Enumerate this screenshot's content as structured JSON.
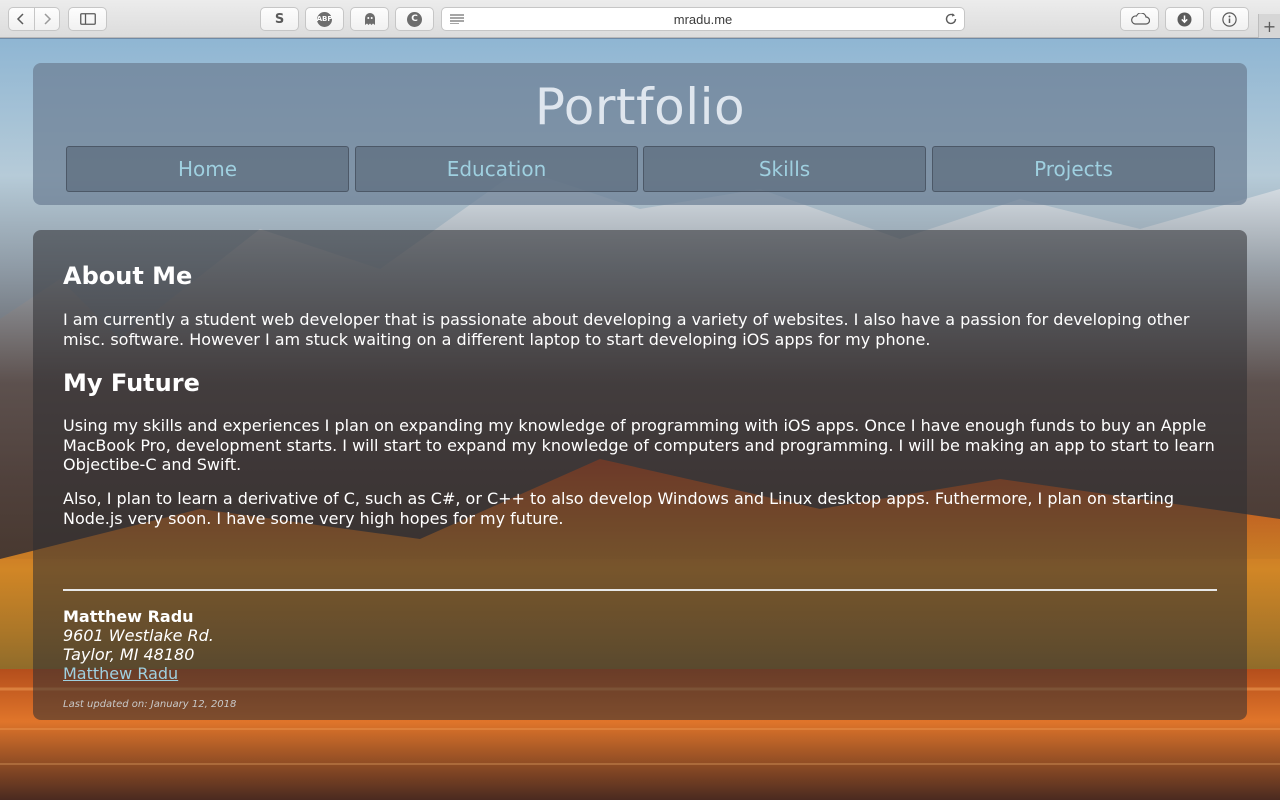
{
  "browser": {
    "url": "mradu.me",
    "extensions": [
      "S",
      "ABP",
      "ghost",
      "C"
    ],
    "new_tab_glyph": "+"
  },
  "site": {
    "title": "Portfolio",
    "nav": [
      "Home",
      "Education",
      "Skills",
      "Projects"
    ]
  },
  "about": {
    "heading": "About Me",
    "body": "I am currently a student web developer that is passionate about developing a variety of websites. I also have a passion for developing other misc. software. However I am stuck waiting on a different laptop to start developing iOS apps for my phone."
  },
  "future": {
    "heading": "My Future",
    "paragraph1": "Using my skills and experiences I plan on expanding my knowledge of programming with iOS apps. Once I have enough funds to buy an Apple MacBook Pro, development starts. I will start to expand my knowledge of computers and programming. I will be making an app to start to learn Objectibe-C and Swift.",
    "paragraph2": "Also, I plan to learn a derivative of C, such as C#, or C++ to also develop Windows and Linux desktop apps. Futhermore, I plan on starting Node.js very soon. I have some very high hopes for my future."
  },
  "footer": {
    "name": "Matthew Radu",
    "address_line1": "9601 Westlake Rd.",
    "address_line2": "Taylor, MI 48180",
    "link_text": "Matthew Radu",
    "updated": "Last updated on: January 12, 2018"
  },
  "colors": {
    "nav_text": "#9fd0e0",
    "link": "#9fd0e0",
    "title": "#dfe6ee"
  }
}
